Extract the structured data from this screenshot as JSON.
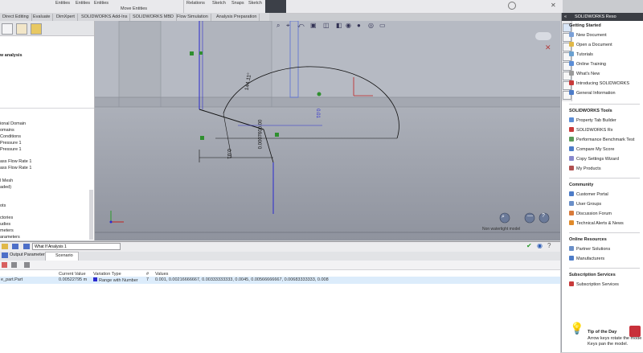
{
  "ribbon": {
    "items": [
      "Entities",
      "Entities",
      "Entities",
      "Move Entities",
      "Relations",
      "Sketch",
      "Snaps",
      "Sketch"
    ]
  },
  "tabs": [
    "Direct Editing",
    "Evaluate",
    "DimXpert",
    "SOLIDWORKS Add-Ins",
    "SOLIDWORKS MBD",
    "Flow Simulation",
    "Analysis Preparation"
  ],
  "left_panel": {
    "title": "w analysis",
    "tree": [
      "ional Domain",
      "omains",
      "Conditions",
      "Pressure 1",
      "Pressure 1",
      "ass Flow Rate 1",
      "ass Flow Rate 1",
      "l Mesh",
      "aded)",
      "ots",
      "ctories",
      "udies",
      "meters",
      "arameters"
    ]
  },
  "graphics": {
    "dimensions": [
      "144.11°",
      "0.01",
      "0.01",
      "0.0007600.00"
    ],
    "status_text": "Non watertight model"
  },
  "task_pane": {
    "title": "SOLIDWORKS Reso",
    "sections": [
      {
        "title": "Getting Started",
        "items": [
          "New Document",
          "Open a Document",
          "Tutorials",
          "Online Training",
          "What's New",
          "Introducing SOLIDWORKS",
          "General Information"
        ]
      },
      {
        "title": "SOLIDWORKS Tools",
        "items": [
          "Property Tab Builder",
          "SOLIDWORKS Rx",
          "Performance Benchmark Test",
          "Compare My Score",
          "Copy Settings Wizard",
          "My Products"
        ]
      },
      {
        "title": "Community",
        "items": [
          "Customer Portal",
          "User Groups",
          "Discussion Forum",
          "Technical Alerts & News"
        ]
      },
      {
        "title": "Online Resources",
        "items": [
          "Partner Solutions",
          "Manufacturers"
        ]
      },
      {
        "title": "Subscription Services",
        "items": [
          "Subscription Services"
        ]
      }
    ],
    "tip": {
      "title": "Tip of the Day",
      "line1": "Arrow keys rotate the mode",
      "line2": "Keys pan the model."
    }
  },
  "bottom_panel": {
    "analysis_name": "What If Analysis 1",
    "tabs": [
      "Output Parameters",
      "Scenario"
    ],
    "columns": [
      "Current Value",
      "Variation Type",
      "#",
      "Values"
    ],
    "row": {
      "name": "e_part.Part",
      "current_value": "0.00522795 m",
      "variation": "Range with Number",
      "count": "7",
      "values": "0.001, 0.00216666667, 0.00333333333, 0.0045, 0.00566666667, 0.00683333333, 0.008"
    }
  },
  "colors": {
    "accent_green": "#2f8f2f",
    "sketch_blue": "#2a2ad0",
    "selection_row": "#dcecfb"
  }
}
